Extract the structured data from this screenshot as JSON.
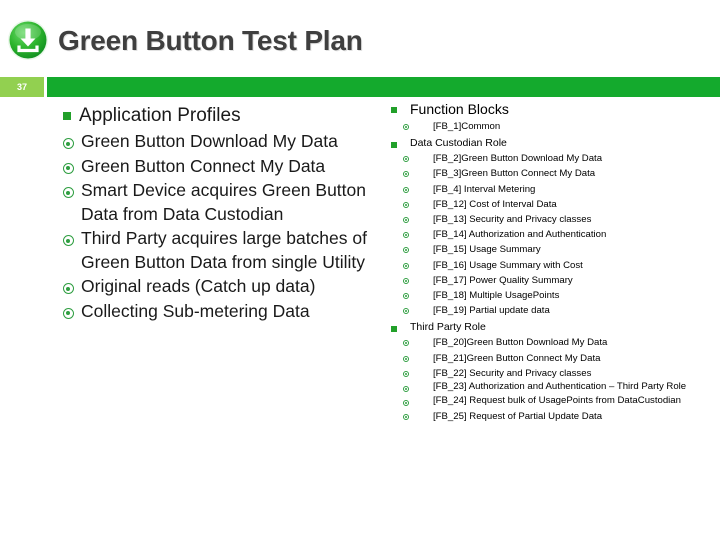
{
  "header": {
    "logo_icon": "green-button-download-icon",
    "title": "Green Button Test Plan"
  },
  "slide_number": "37",
  "colors": {
    "brand_green": "#14aa2d",
    "light_green": "#92d050",
    "bullet_green": "#22a02a",
    "title_gray": "#3f3f3f"
  },
  "left_column": {
    "heading": "Application Profiles",
    "items": [
      "Green Button Download My Data",
      "Green Button Connect My Data",
      "Smart Device acquires Green Button Data from Data Custodian",
      "Third Party acquires large batches of Green Button Data from single Utility",
      "Original reads (Catch up data)",
      "Collecting Sub-metering Data"
    ]
  },
  "right_column": {
    "heading": "Function Blocks",
    "common_items": [
      "[FB_1]Common"
    ],
    "groups": [
      {
        "title": "Data Custodian Role",
        "items": [
          "[FB_2]Green Button Download My Data",
          "[FB_3]Green Button Connect My Data",
          "[FB_4] Interval Metering",
          "[FB_12] Cost of Interval Data",
          "[FB_13] Security and Privacy classes",
          "[FB_14] Authorization and Authentication",
          "[FB_15] Usage Summary",
          "[FB_16] Usage Summary with Cost",
          "[FB_17] Power Quality Summary",
          "[FB_18] Multiple UsagePoints",
          "[FB_19] Partial update data"
        ]
      },
      {
        "title": "Third Party Role",
        "items": [
          "[FB_20]Green Button Download My Data",
          "[FB_21]Green Button Connect My Data",
          "[FB_22] Security and Privacy classes",
          "[FB_23] Authorization and Authentication – Third Party Role",
          "[FB_24] Request bulk of UsagePoints from DataCustodian",
          "[FB_25] Request of Partial Update Data"
        ]
      }
    ]
  }
}
